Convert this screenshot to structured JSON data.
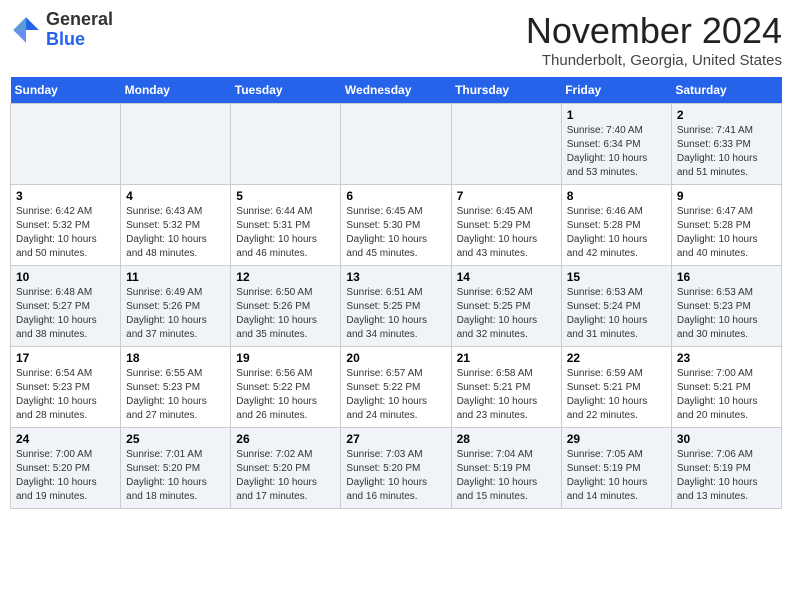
{
  "header": {
    "logo_general": "General",
    "logo_blue": "Blue",
    "month_title": "November 2024",
    "location": "Thunderbolt, Georgia, United States"
  },
  "days_of_week": [
    "Sunday",
    "Monday",
    "Tuesday",
    "Wednesday",
    "Thursday",
    "Friday",
    "Saturday"
  ],
  "weeks": [
    [
      {
        "day": "",
        "info": ""
      },
      {
        "day": "",
        "info": ""
      },
      {
        "day": "",
        "info": ""
      },
      {
        "day": "",
        "info": ""
      },
      {
        "day": "",
        "info": ""
      },
      {
        "day": "1",
        "info": "Sunrise: 7:40 AM\nSunset: 6:34 PM\nDaylight: 10 hours and 53 minutes."
      },
      {
        "day": "2",
        "info": "Sunrise: 7:41 AM\nSunset: 6:33 PM\nDaylight: 10 hours and 51 minutes."
      }
    ],
    [
      {
        "day": "3",
        "info": "Sunrise: 6:42 AM\nSunset: 5:32 PM\nDaylight: 10 hours and 50 minutes."
      },
      {
        "day": "4",
        "info": "Sunrise: 6:43 AM\nSunset: 5:32 PM\nDaylight: 10 hours and 48 minutes."
      },
      {
        "day": "5",
        "info": "Sunrise: 6:44 AM\nSunset: 5:31 PM\nDaylight: 10 hours and 46 minutes."
      },
      {
        "day": "6",
        "info": "Sunrise: 6:45 AM\nSunset: 5:30 PM\nDaylight: 10 hours and 45 minutes."
      },
      {
        "day": "7",
        "info": "Sunrise: 6:45 AM\nSunset: 5:29 PM\nDaylight: 10 hours and 43 minutes."
      },
      {
        "day": "8",
        "info": "Sunrise: 6:46 AM\nSunset: 5:28 PM\nDaylight: 10 hours and 42 minutes."
      },
      {
        "day": "9",
        "info": "Sunrise: 6:47 AM\nSunset: 5:28 PM\nDaylight: 10 hours and 40 minutes."
      }
    ],
    [
      {
        "day": "10",
        "info": "Sunrise: 6:48 AM\nSunset: 5:27 PM\nDaylight: 10 hours and 38 minutes."
      },
      {
        "day": "11",
        "info": "Sunrise: 6:49 AM\nSunset: 5:26 PM\nDaylight: 10 hours and 37 minutes."
      },
      {
        "day": "12",
        "info": "Sunrise: 6:50 AM\nSunset: 5:26 PM\nDaylight: 10 hours and 35 minutes."
      },
      {
        "day": "13",
        "info": "Sunrise: 6:51 AM\nSunset: 5:25 PM\nDaylight: 10 hours and 34 minutes."
      },
      {
        "day": "14",
        "info": "Sunrise: 6:52 AM\nSunset: 5:25 PM\nDaylight: 10 hours and 32 minutes."
      },
      {
        "day": "15",
        "info": "Sunrise: 6:53 AM\nSunset: 5:24 PM\nDaylight: 10 hours and 31 minutes."
      },
      {
        "day": "16",
        "info": "Sunrise: 6:53 AM\nSunset: 5:23 PM\nDaylight: 10 hours and 30 minutes."
      }
    ],
    [
      {
        "day": "17",
        "info": "Sunrise: 6:54 AM\nSunset: 5:23 PM\nDaylight: 10 hours and 28 minutes."
      },
      {
        "day": "18",
        "info": "Sunrise: 6:55 AM\nSunset: 5:23 PM\nDaylight: 10 hours and 27 minutes."
      },
      {
        "day": "19",
        "info": "Sunrise: 6:56 AM\nSunset: 5:22 PM\nDaylight: 10 hours and 26 minutes."
      },
      {
        "day": "20",
        "info": "Sunrise: 6:57 AM\nSunset: 5:22 PM\nDaylight: 10 hours and 24 minutes."
      },
      {
        "day": "21",
        "info": "Sunrise: 6:58 AM\nSunset: 5:21 PM\nDaylight: 10 hours and 23 minutes."
      },
      {
        "day": "22",
        "info": "Sunrise: 6:59 AM\nSunset: 5:21 PM\nDaylight: 10 hours and 22 minutes."
      },
      {
        "day": "23",
        "info": "Sunrise: 7:00 AM\nSunset: 5:21 PM\nDaylight: 10 hours and 20 minutes."
      }
    ],
    [
      {
        "day": "24",
        "info": "Sunrise: 7:00 AM\nSunset: 5:20 PM\nDaylight: 10 hours and 19 minutes."
      },
      {
        "day": "25",
        "info": "Sunrise: 7:01 AM\nSunset: 5:20 PM\nDaylight: 10 hours and 18 minutes."
      },
      {
        "day": "26",
        "info": "Sunrise: 7:02 AM\nSunset: 5:20 PM\nDaylight: 10 hours and 17 minutes."
      },
      {
        "day": "27",
        "info": "Sunrise: 7:03 AM\nSunset: 5:20 PM\nDaylight: 10 hours and 16 minutes."
      },
      {
        "day": "28",
        "info": "Sunrise: 7:04 AM\nSunset: 5:19 PM\nDaylight: 10 hours and 15 minutes."
      },
      {
        "day": "29",
        "info": "Sunrise: 7:05 AM\nSunset: 5:19 PM\nDaylight: 10 hours and 14 minutes."
      },
      {
        "day": "30",
        "info": "Sunrise: 7:06 AM\nSunset: 5:19 PM\nDaylight: 10 hours and 13 minutes."
      }
    ]
  ]
}
